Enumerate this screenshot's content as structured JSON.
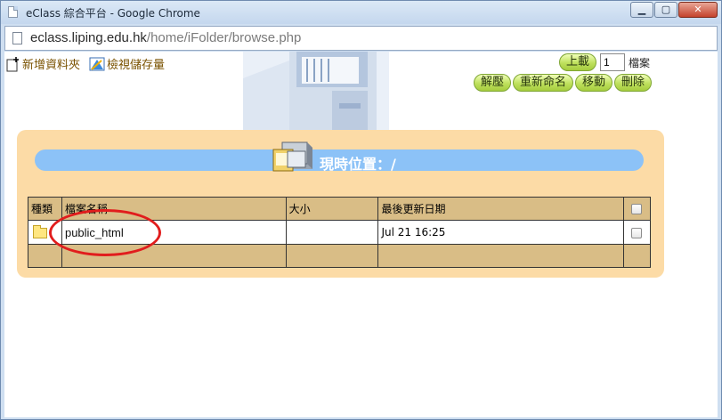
{
  "window": {
    "title": "eClass 綜合平台 - Google Chrome",
    "buttons": {
      "minimize": "▁",
      "maximize": "▢",
      "close": "✕"
    }
  },
  "address": {
    "host": "eclass.liping.edu.hk",
    "path": "/home/iFolder/browse.php"
  },
  "toolbar": {
    "new_folder": "新增資料夾",
    "view_storage": "檢視儲存量",
    "upload": "上載",
    "file_count": "1",
    "file_unit": "檔案",
    "unzip": "解壓",
    "rename": "重新命名",
    "move": "移動",
    "delete": "刪除"
  },
  "location": {
    "label": "現時位置：/"
  },
  "table": {
    "headers": {
      "type": "種類",
      "name": "檔案名稱",
      "size": "大小",
      "modified": "最後更新日期"
    },
    "rows": [
      {
        "name": "public_html",
        "size": "",
        "modified": "Jul 21 16:25"
      }
    ]
  },
  "colors": {
    "panel": "#fcdba6",
    "table_header": "#d9bd86",
    "location_bar": "#8cc2f7",
    "highlight": "#e11d1d"
  },
  "icons": [
    "page-icon",
    "new-folder-icon",
    "storage-icon",
    "file-cabinet-icon",
    "folder-icon"
  ]
}
